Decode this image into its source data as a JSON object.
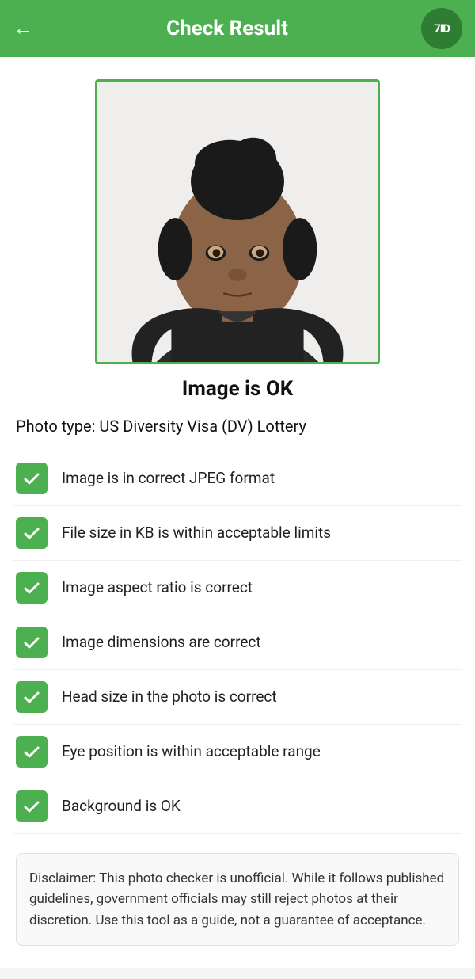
{
  "header": {
    "title": "Check Result",
    "back_icon": "←",
    "logo_text": "7ID"
  },
  "photo": {
    "alt": "Passport photo of a young woman"
  },
  "result": {
    "status": "Image is OK",
    "photo_type_label": "Photo type: US Diversity Visa (DV) Lottery"
  },
  "checks": [
    {
      "id": 1,
      "label": "Image is in correct JPEG format"
    },
    {
      "id": 2,
      "label": "File size in KB is within acceptable limits"
    },
    {
      "id": 3,
      "label": "Image aspect ratio is correct"
    },
    {
      "id": 4,
      "label": "Image dimensions are correct"
    },
    {
      "id": 5,
      "label": "Head size in the photo is correct"
    },
    {
      "id": 6,
      "label": "Eye position is within acceptable range"
    },
    {
      "id": 7,
      "label": "Background is OK"
    }
  ],
  "disclaimer": {
    "text": "Disclaimer: This photo checker is unofficial. While it follows published guidelines, government officials may still reject photos at their discretion. Use this tool as a guide, not a guarantee of acceptance."
  }
}
